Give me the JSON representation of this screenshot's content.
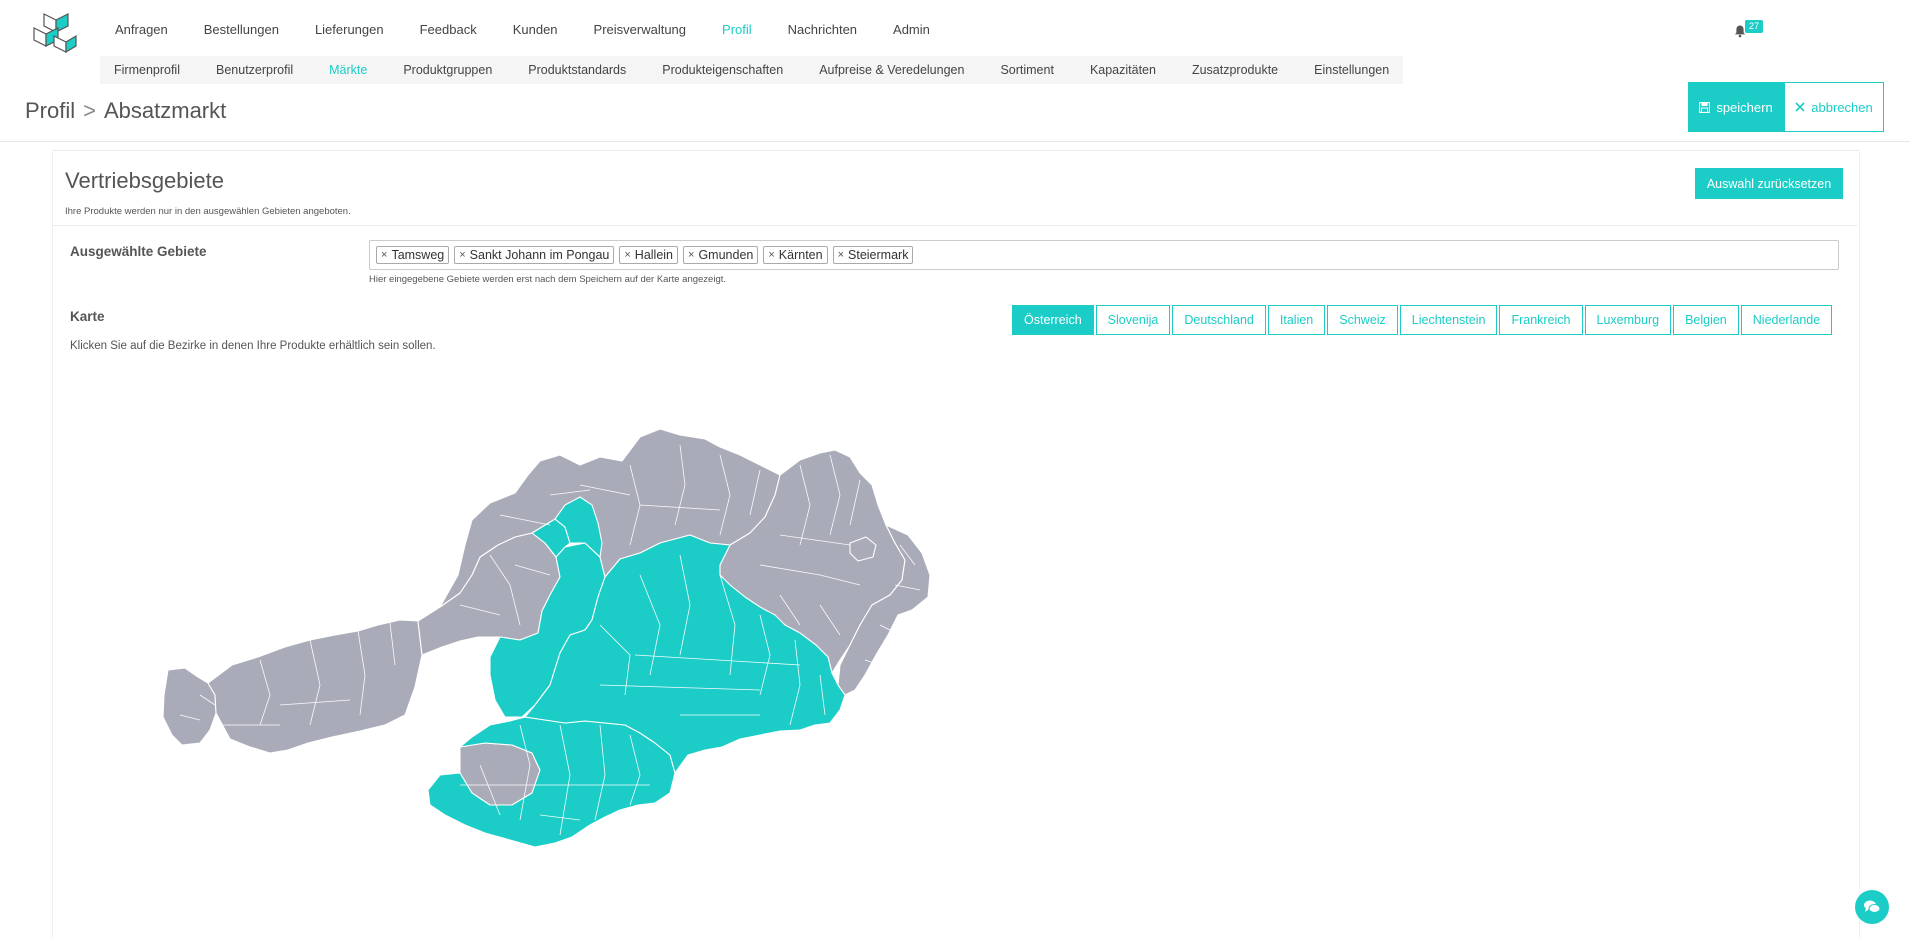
{
  "nav": {
    "main": [
      "Anfragen",
      "Bestellungen",
      "Lieferungen",
      "Feedback",
      "Kunden",
      "Preisverwaltung",
      "Profil",
      "Nachrichten",
      "Admin"
    ],
    "main_active": 6,
    "sub": [
      "Firmenprofil",
      "Benutzerprofil",
      "Märkte",
      "Produktgruppen",
      "Produktstandards",
      "Produkteigenschaften",
      "Aufpreise & Veredelungen",
      "Sortiment",
      "Kapazitäten",
      "Zusatzprodukte",
      "Einstellungen"
    ],
    "sub_active": 2
  },
  "notifications": {
    "count": "27",
    "icon": "bell-icon"
  },
  "breadcrumb": {
    "parent": "Profil",
    "separator": ">",
    "current": "Absatzmarkt"
  },
  "actions": {
    "save": "speichern",
    "cancel": "abbrechen"
  },
  "section": {
    "title": "Vertriebsgebiete",
    "subtitle": "Ihre Produkte werden nur in den ausgewählen Gebieten angeboten.",
    "reset": "Auswahl zurücksetzen"
  },
  "selected": {
    "label": "Ausgewählte Gebiete",
    "tags": [
      "Tamsweg",
      "Sankt Johann im Pongau",
      "Hallein",
      "Gmunden",
      "Kärnten",
      "Steiermark"
    ],
    "remove_glyph": "×",
    "hint": "Hier eingegebene Gebiete werden erst nach dem Speichern auf der Karte angezeigt."
  },
  "map": {
    "label": "Karte",
    "hint": "Klicken Sie auf die Bezirke in denen Ihre Produkte erhältlich sein sollen.",
    "countries": [
      "Österreich",
      "Slovenija",
      "Deutschland",
      "Italien",
      "Schweiz",
      "Liechtenstein",
      "Frankreich",
      "Luxemburg",
      "Belgien",
      "Niederlande"
    ],
    "active_country": 0,
    "colors": {
      "selected": "#1bcdc6",
      "unselected": "#a9abb8",
      "border": "#ffffff"
    }
  },
  "colors": {
    "accent": "#1bcdc6"
  }
}
